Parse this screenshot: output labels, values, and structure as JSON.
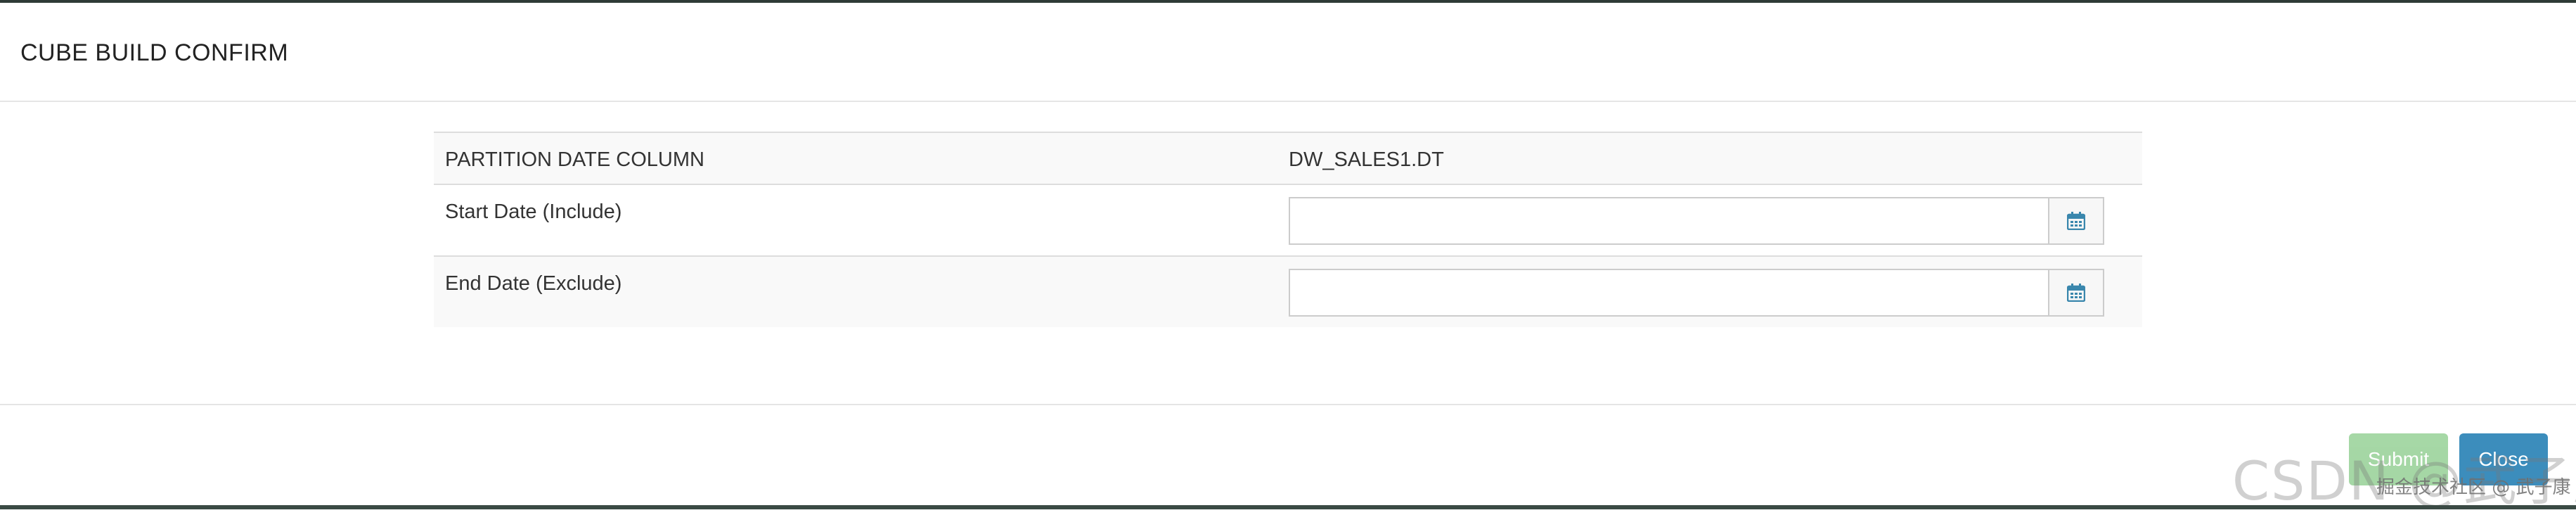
{
  "modal": {
    "title": "CUBE BUILD CONFIRM",
    "rows": [
      {
        "label": "PARTITION DATE COLUMN",
        "value": "DW_SALES1.DT"
      },
      {
        "label": "Start Date (Include)",
        "input_value": "",
        "icon": "calendar-icon"
      },
      {
        "label": "End Date (Exclude)",
        "input_value": "",
        "icon": "calendar-icon"
      }
    ]
  },
  "footer": {
    "submit_label": "Submit",
    "close_label": "Close"
  },
  "watermark": {
    "main": "CSDN @武子康",
    "sub": "掘金技术社区 @ 武子康"
  },
  "colors": {
    "submit": "#5cb85c",
    "close": "#3c8dbc",
    "calendar": "#3a87ad"
  }
}
